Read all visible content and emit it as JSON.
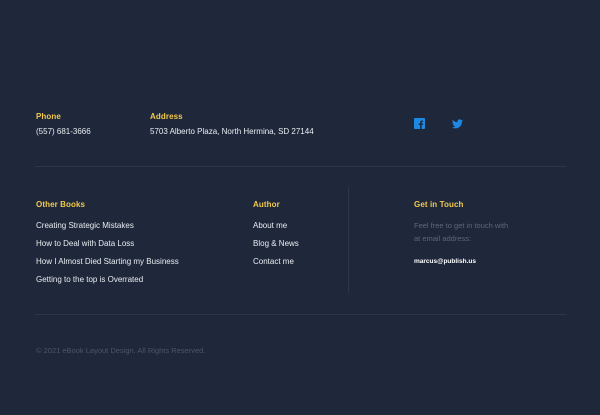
{
  "contact": {
    "phone_label": "Phone",
    "phone": "(557) 681-3666",
    "address_label": "Address",
    "address": "5703 Alberto Plaza, North Hermina, SD 27144"
  },
  "social": {
    "icons": [
      "facebook-icon",
      "twitter-icon"
    ],
    "color": "#1e88e5"
  },
  "other_books": {
    "title": "Other Books",
    "links": [
      "Creating Strategic Mistakes",
      "How to Deal with Data Loss",
      "How I Almost Died Starting my Business",
      "Getting to the top is Overrated"
    ]
  },
  "author": {
    "title": "Author",
    "links": [
      "About me",
      "Blog & News",
      "Contact me"
    ]
  },
  "get_in_touch": {
    "title": "Get in Touch",
    "text_line1": "Feel free to get in touch with",
    "text_line2": "at email address:",
    "email": "marcus@publish.us"
  },
  "footer": {
    "copyright": "© 2021 eBook Layout Design. All Rights Reserved."
  },
  "colors": {
    "background": "#1f283a",
    "heading": "#f2c94c",
    "text": "#e8ecf2"
  }
}
